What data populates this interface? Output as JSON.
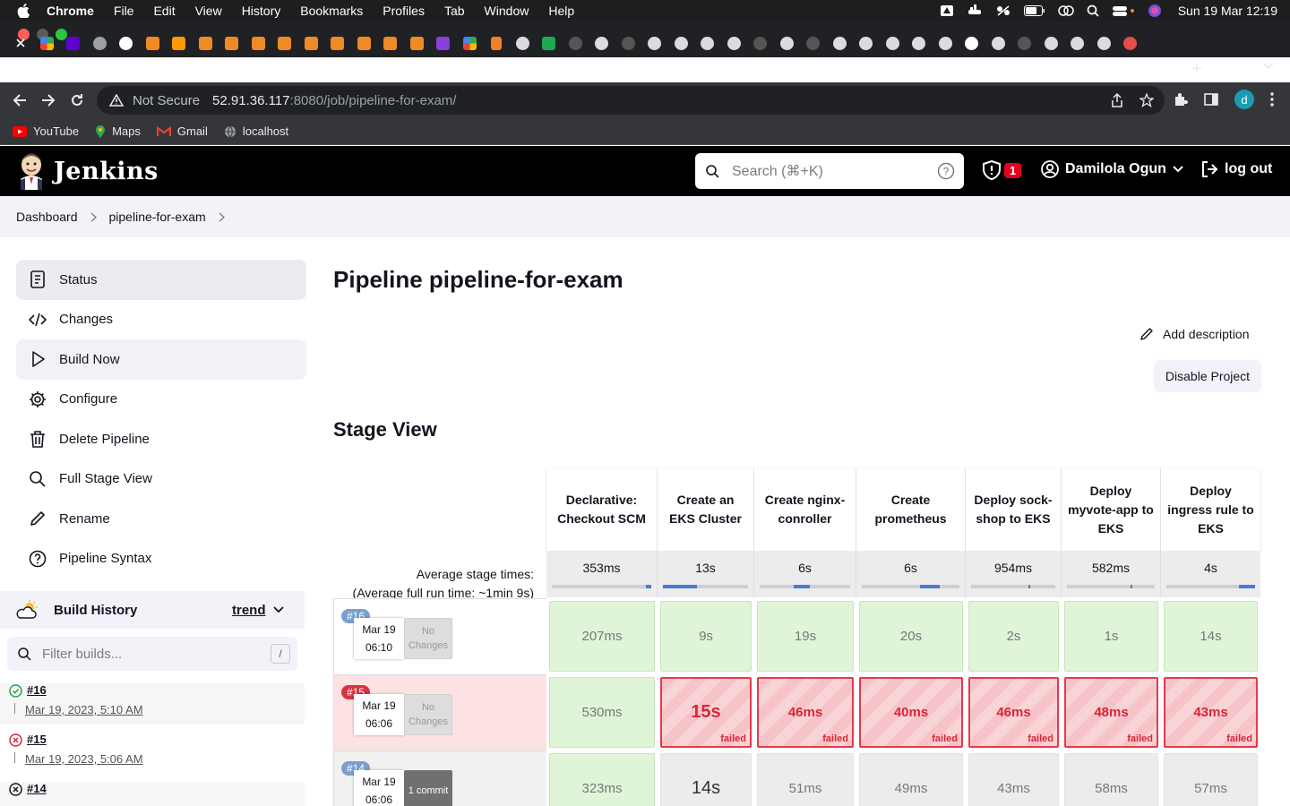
{
  "menubar": {
    "app": "Chrome",
    "items": [
      "File",
      "Edit",
      "View",
      "History",
      "Bookmarks",
      "Profiles",
      "Tab",
      "Window",
      "Help"
    ],
    "clock": "Sun 19 Mar  12:19"
  },
  "colors": {
    "jenkins_header": "#000000",
    "success": "#e0f5d8",
    "failed": "#e53a4a",
    "badge": "#e6001f",
    "build_blue": "#7a9fcf",
    "build_red": "#d63340"
  },
  "address_bar": {
    "security": "Not Secure",
    "host": "52.91.36.117",
    "path": ":8080/job/pipeline-for-exam/"
  },
  "bookmarks": [
    {
      "label": "YouTube",
      "icon": "youtube-icon"
    },
    {
      "label": "Maps",
      "icon": "maps-icon"
    },
    {
      "label": "Gmail",
      "icon": "gmail-icon"
    },
    {
      "label": "localhost",
      "icon": "globe-icon"
    }
  ],
  "profile_initial": "d",
  "header": {
    "brand": "Jenkins",
    "search_placeholder": "Search (⌘+K)",
    "security_count": "1",
    "user": "Damilola Ogun",
    "logout": "log out"
  },
  "breadcrumb": [
    "Dashboard",
    "pipeline-for-exam"
  ],
  "sidebar": {
    "items": [
      {
        "label": "Status",
        "icon": "document-icon"
      },
      {
        "label": "Changes",
        "icon": "code-icon"
      },
      {
        "label": "Build Now",
        "icon": "play-icon"
      },
      {
        "label": "Configure",
        "icon": "gear-icon"
      },
      {
        "label": "Delete Pipeline",
        "icon": "trash-icon"
      },
      {
        "label": "Full Stage View",
        "icon": "search-icon"
      },
      {
        "label": "Rename",
        "icon": "pencil-icon"
      },
      {
        "label": "Pipeline Syntax",
        "icon": "help-icon"
      }
    ],
    "build_history": {
      "title": "Build History",
      "trend": "trend",
      "filter_placeholder": "Filter builds...",
      "shortcut": "/"
    },
    "history": [
      {
        "num": "#16",
        "date": "Mar 19, 2023, 5:10 AM",
        "status": "success"
      },
      {
        "num": "#15",
        "date": "Mar 19, 2023, 5:06 AM",
        "status": "failed"
      },
      {
        "num": "#14",
        "date": "",
        "status": "aborted"
      }
    ]
  },
  "main": {
    "title": "Pipeline pipeline-for-exam",
    "add_description": "Add description",
    "disable_project": "Disable Project",
    "stage_view": "Stage View",
    "avg_label_1": "Average stage times:",
    "avg_label_2a": "(Average ",
    "avg_label_2b": "full",
    "avg_label_2c": " run time: ~1min 9s)",
    "stages": [
      {
        "name": "Declarative: Checkout SCM",
        "avg": "353ms",
        "bar": [
          0.95,
          1.0
        ]
      },
      {
        "name": "Create an EKS Cluster",
        "avg": "13s",
        "bar": [
          0.0,
          0.4
        ]
      },
      {
        "name": "Create nginx-conroller",
        "avg": "6s",
        "bar": [
          0.38,
          0.55
        ]
      },
      {
        "name": "Create prometheus",
        "avg": "6s",
        "bar": [
          0.6,
          0.8
        ]
      },
      {
        "name": "Deploy sock-shop to EKS",
        "avg": "954ms",
        "bar": [
          0.68,
          0.7
        ]
      },
      {
        "name": "Deploy myvote-app to EKS",
        "avg": "582ms",
        "bar": [
          0.72,
          0.74
        ]
      },
      {
        "name": "Deploy ingress rule to EKS",
        "avg": "4s",
        "bar": [
          0.82,
          1.0
        ]
      }
    ],
    "builds": [
      {
        "num": "#16",
        "date": "Mar 19",
        "time": "06:10",
        "changes": "No Changes",
        "status": "blue",
        "cells": [
          {
            "v": "207ms",
            "s": "ok"
          },
          {
            "v": "9s",
            "s": "ok"
          },
          {
            "v": "19s",
            "s": "ok"
          },
          {
            "v": "20s",
            "s": "ok"
          },
          {
            "v": "2s",
            "s": "ok"
          },
          {
            "v": "1s",
            "s": "ok"
          },
          {
            "v": "14s",
            "s": "ok"
          }
        ]
      },
      {
        "num": "#15",
        "date": "Mar 19",
        "time": "06:06",
        "changes": "No Changes",
        "status": "red",
        "cells": [
          {
            "v": "530ms",
            "s": "ok"
          },
          {
            "v": "15s",
            "s": "fail"
          },
          {
            "v": "46ms",
            "s": "fail"
          },
          {
            "v": "40ms",
            "s": "fail"
          },
          {
            "v": "46ms",
            "s": "fail"
          },
          {
            "v": "48ms",
            "s": "fail"
          },
          {
            "v": "43ms",
            "s": "fail"
          }
        ]
      },
      {
        "num": "#14",
        "date": "Mar 19",
        "time": "06:06",
        "changes": "1 commit",
        "status": "blue",
        "cells": [
          {
            "v": "323ms",
            "s": "ok"
          },
          {
            "v": "14s",
            "s": "grey"
          },
          {
            "v": "51ms",
            "s": "grey"
          },
          {
            "v": "49ms",
            "s": "grey"
          },
          {
            "v": "43ms",
            "s": "grey"
          },
          {
            "v": "58ms",
            "s": "grey"
          },
          {
            "v": "57ms",
            "s": "grey"
          }
        ]
      }
    ],
    "failed_tag": "failed"
  }
}
